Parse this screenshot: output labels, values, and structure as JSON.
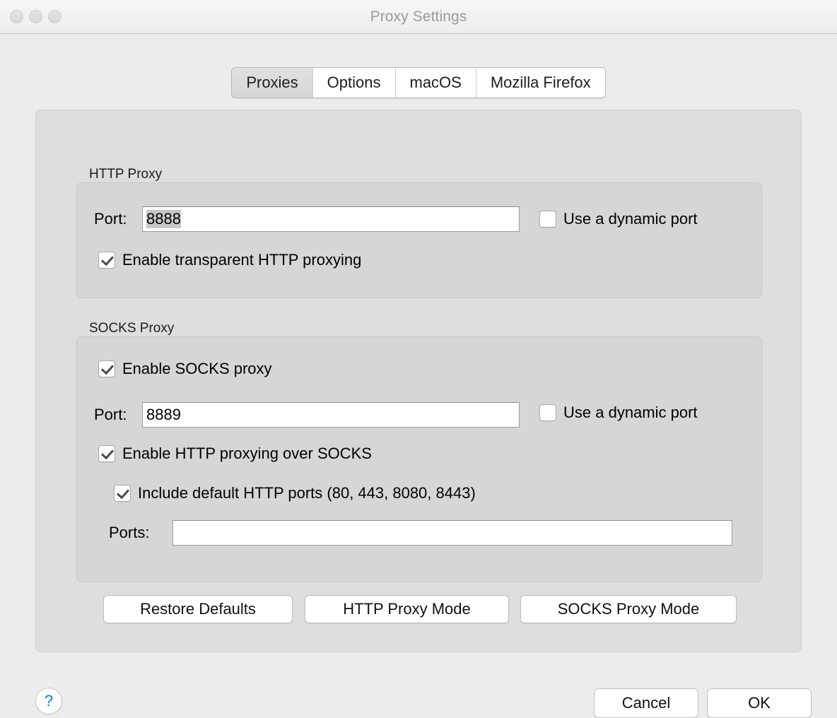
{
  "window": {
    "title": "Proxy Settings",
    "traffic_lights": [
      "close",
      "minimize",
      "zoom"
    ]
  },
  "tabs": [
    {
      "label": "Proxies",
      "selected": true
    },
    {
      "label": "Options",
      "selected": false
    },
    {
      "label": "macOS",
      "selected": false
    },
    {
      "label": "Mozilla Firefox",
      "selected": false
    }
  ],
  "http_proxy": {
    "group_label": "HTTP Proxy",
    "port_label": "Port:",
    "port_value": "8888",
    "port_value_selected": true,
    "dynamic_port_label": "Use a dynamic port",
    "dynamic_port_checked": false,
    "transparent_label": "Enable transparent HTTP proxying",
    "transparent_checked": true
  },
  "socks_proxy": {
    "group_label": "SOCKS Proxy",
    "enable_label": "Enable SOCKS proxy",
    "enable_checked": true,
    "port_label": "Port:",
    "port_value": "8889",
    "dynamic_port_label": "Use a dynamic port",
    "dynamic_port_checked": false,
    "http_over_socks_label": "Enable HTTP proxying over SOCKS",
    "http_over_socks_checked": true,
    "include_default_label": "Include default HTTP ports (80, 443, 8080, 8443)",
    "include_default_checked": true,
    "ports_label": "Ports:",
    "ports_value": ""
  },
  "action_buttons": {
    "restore_defaults": "Restore Defaults",
    "http_proxy_mode": "HTTP Proxy Mode",
    "socks_proxy_mode": "SOCKS Proxy Mode"
  },
  "bottom_bar": {
    "help": "?",
    "cancel": "Cancel",
    "ok": "OK"
  },
  "colors": {
    "window_bg": "#ececec",
    "panel_bg": "#dededf",
    "group_bg": "#d6d6d7",
    "title_text": "#9a9a9a",
    "accent_help": "#1474ee",
    "selection_highlight": "#c8c8c8"
  }
}
